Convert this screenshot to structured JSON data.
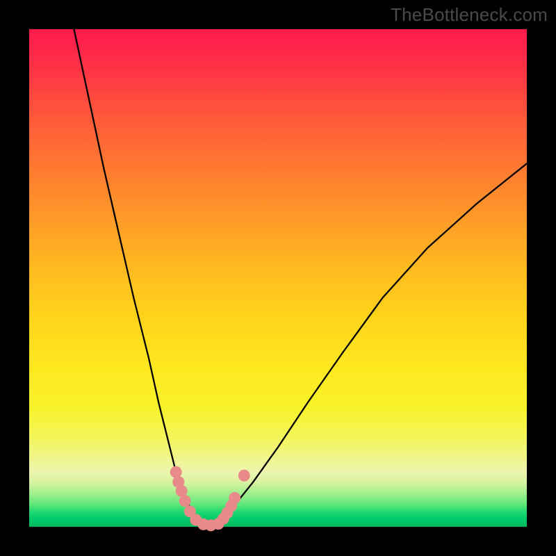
{
  "watermark": "TheBottleneck.com",
  "colors": {
    "background": "#000000",
    "curve": "#000000",
    "dot": "#e88a8a",
    "gradient_top": "#ff1a4d",
    "gradient_bottom": "#00b862"
  },
  "chart_data": {
    "type": "line",
    "title": "",
    "xlabel": "",
    "ylabel": "",
    "xlim": [
      0,
      100
    ],
    "ylim": [
      0,
      100
    ],
    "series": [
      {
        "name": "left-curve",
        "x": [
          9,
          12,
          15,
          18,
          21,
          24,
          26,
          28,
          29.5,
          31,
          32.5,
          34,
          35,
          36
        ],
        "y": [
          100,
          86,
          72,
          59,
          46,
          34,
          25,
          17,
          11,
          6.5,
          3.5,
          1.5,
          0.6,
          0
        ]
      },
      {
        "name": "right-curve",
        "x": [
          36,
          38,
          41,
          45,
          50,
          56,
          63,
          71,
          80,
          90,
          100
        ],
        "y": [
          0,
          1.2,
          4,
          9,
          16,
          25,
          35,
          46,
          56,
          65,
          73
        ]
      }
    ],
    "dots": [
      {
        "x": 29.5,
        "y": 11.0
      },
      {
        "x": 30.0,
        "y": 9.0
      },
      {
        "x": 30.6,
        "y": 7.2
      },
      {
        "x": 31.3,
        "y": 5.2
      },
      {
        "x": 32.3,
        "y": 3.1
      },
      {
        "x": 33.5,
        "y": 1.4
      },
      {
        "x": 35.0,
        "y": 0.5
      },
      {
        "x": 36.5,
        "y": 0.3
      },
      {
        "x": 38.0,
        "y": 0.6
      },
      {
        "x": 39.0,
        "y": 1.6
      },
      {
        "x": 39.8,
        "y": 2.8
      },
      {
        "x": 40.6,
        "y": 4.2
      },
      {
        "x": 41.3,
        "y": 5.8
      },
      {
        "x": 43.2,
        "y": 10.3
      }
    ],
    "floor_band_y": 12
  }
}
